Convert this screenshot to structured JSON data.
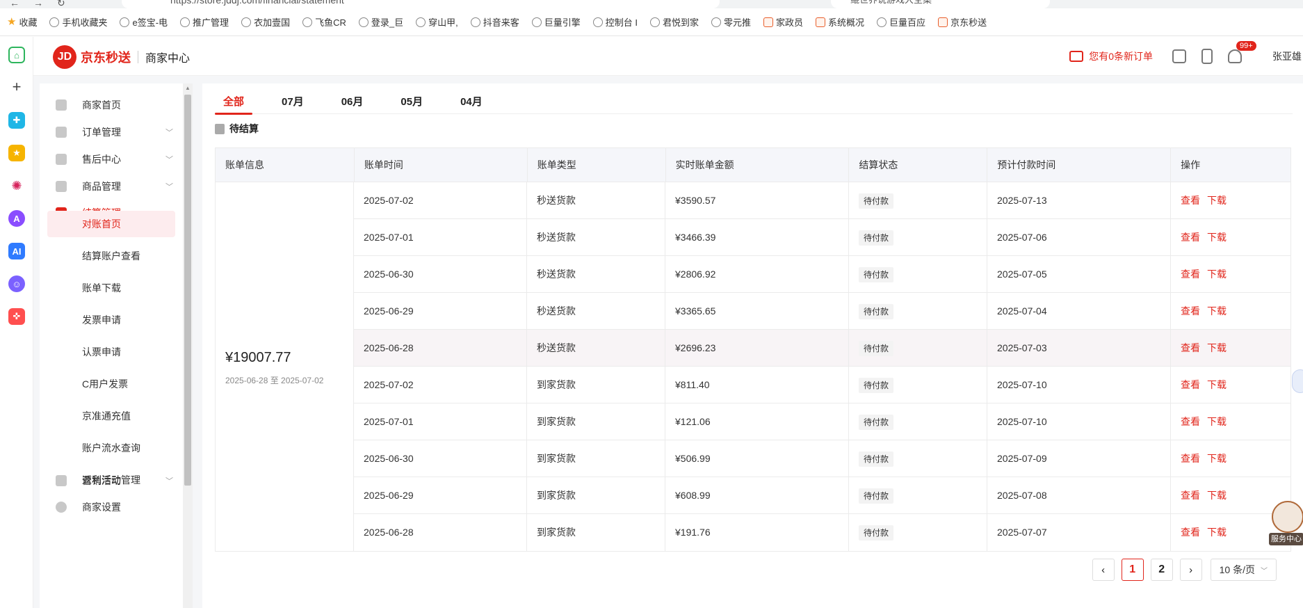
{
  "browser": {
    "url": "https://store.jddj.com/financial/statement",
    "search_text": "鲲世界说游戏大全集",
    "bookmarks": [
      "收藏",
      "手机收藏夹",
      "e签宝-电",
      "推广管理",
      "衣加壹国",
      "飞鱼CR",
      "登录_巨",
      "穿山甲,",
      "抖音来客",
      "巨量引擎",
      "控制台 I",
      "君悦到家",
      "零元推",
      "家政员",
      "系统概况",
      "巨量百应",
      "京东秒送"
    ]
  },
  "header": {
    "brand": "京东秒送",
    "brand_badge": "JD",
    "sub": "商家中心",
    "new_orders": "您有0条新订单",
    "notif_badge": "99+",
    "user": "张亚雄"
  },
  "sidebar": {
    "items": [
      {
        "label": "商家首页"
      },
      {
        "label": "订单管理"
      },
      {
        "label": "售后中心"
      },
      {
        "label": "商品管理"
      },
      {
        "label": "结算管理"
      }
    ],
    "sub_items": [
      "对账首页",
      "结算账户查看",
      "账单下载",
      "发票申请",
      "认票申请",
      "C用户发票",
      "京准通充值",
      "账户流水查询",
      "返利活动管理"
    ],
    "bottom_items": [
      "营销活动",
      "商家设置"
    ]
  },
  "tabs": [
    "全部",
    "07月",
    "06月",
    "05月",
    "04月"
  ],
  "section_title": "待结算",
  "table": {
    "headers": [
      "账单信息",
      "账单时间",
      "账单类型",
      "实时账单金额",
      "结算状态",
      "预计付款时间",
      "操作"
    ],
    "bill_amount": "¥19007.77",
    "bill_range": "2025-06-28 至 2025-07-02",
    "rows": [
      {
        "date": "2025-07-02",
        "type": "秒送货款",
        "amount": "¥3590.57",
        "status": "待付款",
        "pay_date": "2025-07-13"
      },
      {
        "date": "2025-07-01",
        "type": "秒送货款",
        "amount": "¥3466.39",
        "status": "待付款",
        "pay_date": "2025-07-06"
      },
      {
        "date": "2025-06-30",
        "type": "秒送货款",
        "amount": "¥2806.92",
        "status": "待付款",
        "pay_date": "2025-07-05"
      },
      {
        "date": "2025-06-29",
        "type": "秒送货款",
        "amount": "¥3365.65",
        "status": "待付款",
        "pay_date": "2025-07-04"
      },
      {
        "date": "2025-06-28",
        "type": "秒送货款",
        "amount": "¥2696.23",
        "status": "待付款",
        "pay_date": "2025-07-03"
      },
      {
        "date": "2025-07-02",
        "type": "到家货款",
        "amount": "¥811.40",
        "status": "待付款",
        "pay_date": "2025-07-10"
      },
      {
        "date": "2025-07-01",
        "type": "到家货款",
        "amount": "¥121.06",
        "status": "待付款",
        "pay_date": "2025-07-10"
      },
      {
        "date": "2025-06-30",
        "type": "到家货款",
        "amount": "¥506.99",
        "status": "待付款",
        "pay_date": "2025-07-09"
      },
      {
        "date": "2025-06-29",
        "type": "到家货款",
        "amount": "¥608.99",
        "status": "待付款",
        "pay_date": "2025-07-08"
      },
      {
        "date": "2025-06-28",
        "type": "到家货款",
        "amount": "¥191.76",
        "status": "待付款",
        "pay_date": "2025-07-07"
      }
    ],
    "op_view": "查看",
    "op_download": "下载"
  },
  "pager": {
    "pages": [
      "1",
      "2"
    ],
    "page_size": "10 条/页"
  },
  "float_help": "服务中心",
  "colors": {
    "accent": "#e1251b"
  }
}
